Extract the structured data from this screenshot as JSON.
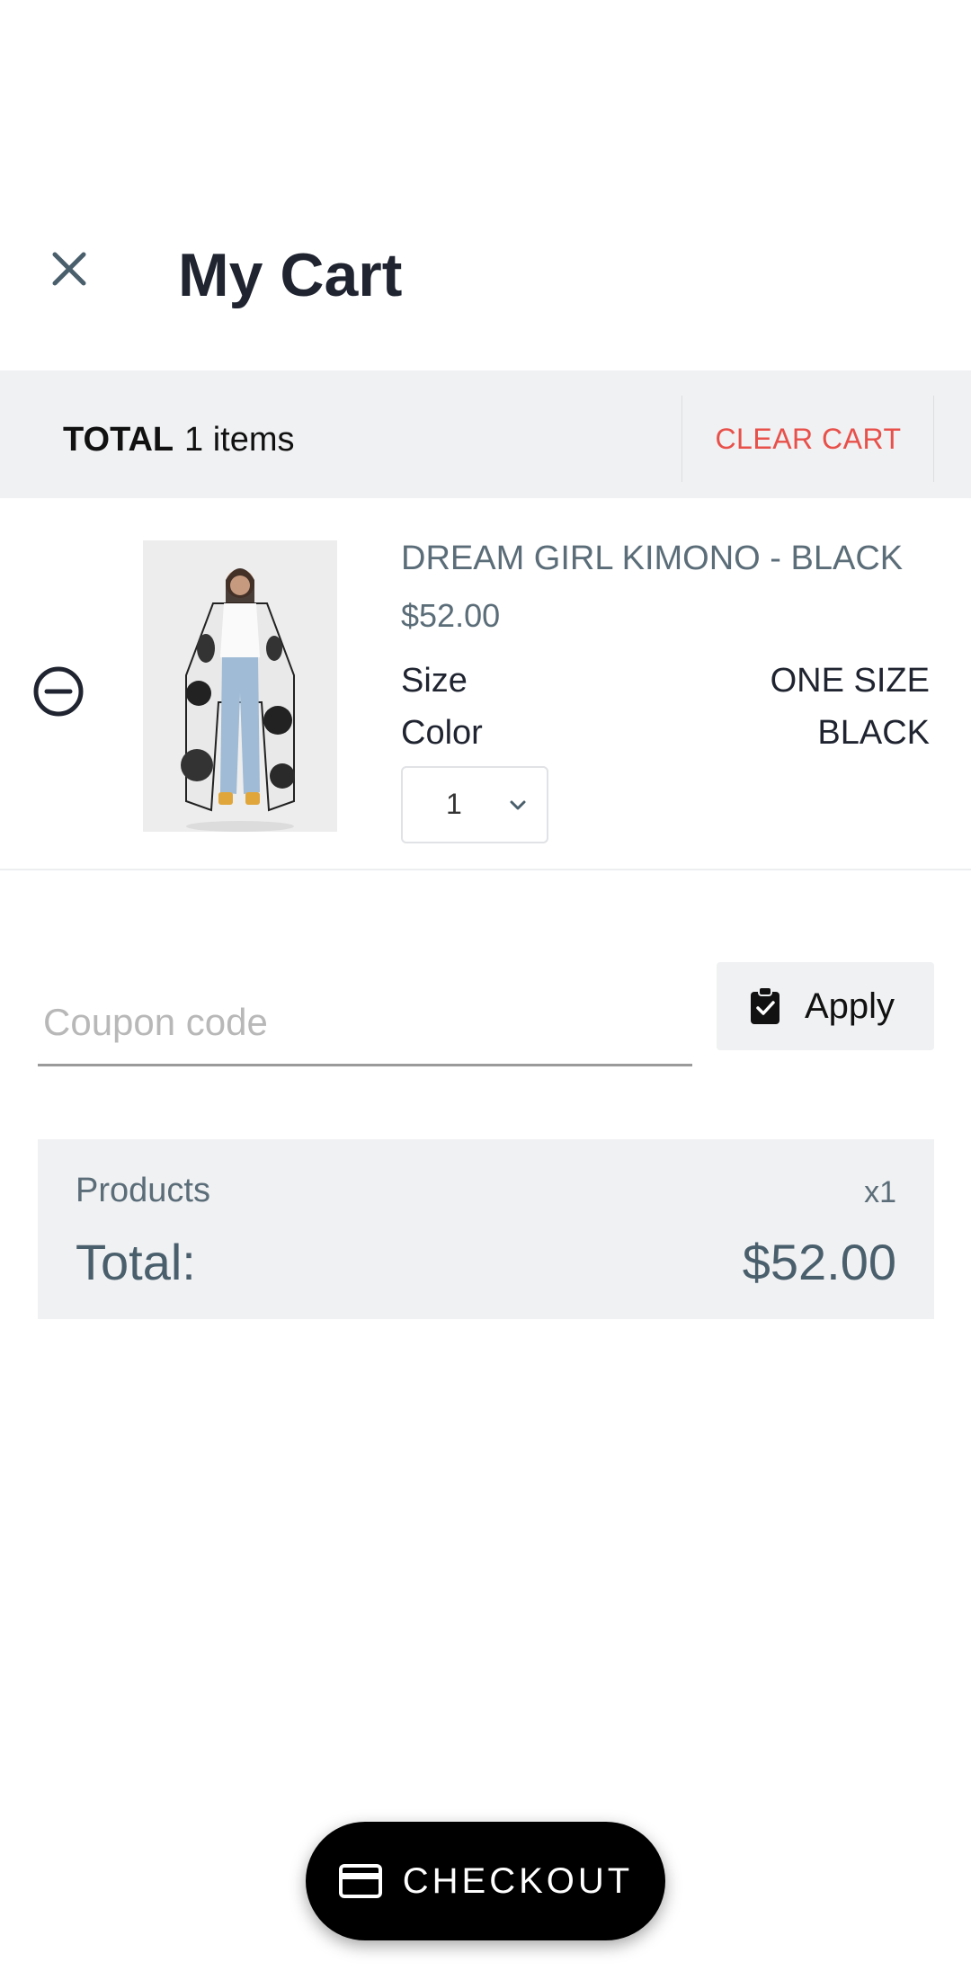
{
  "header": {
    "title": "My Cart"
  },
  "summary_bar": {
    "total_label": "TOTAL",
    "item_count": "1 items",
    "clear_cart_label": "CLEAR CART"
  },
  "cart": {
    "items": [
      {
        "name": "DREAM GIRL KIMONO - BLACK",
        "price": "$52.00",
        "size_label": "Size",
        "size_value": "ONE SIZE",
        "color_label": "Color",
        "color_value": "BLACK",
        "quantity": "1",
        "image_icon": "kimono-product-photo"
      }
    ]
  },
  "coupon": {
    "placeholder": "Coupon code",
    "value": "",
    "apply_label": "Apply"
  },
  "totals": {
    "products_label": "Products",
    "products_qty": "x1",
    "total_label": "Total:",
    "total_value": "$52.00"
  },
  "checkout": {
    "label": "CHECKOUT"
  },
  "colors": {
    "accent_red": "#e8504a",
    "muted_text": "#5b6d78",
    "panel_bg": "#f0f1f3",
    "checkout_bg": "#000000"
  }
}
